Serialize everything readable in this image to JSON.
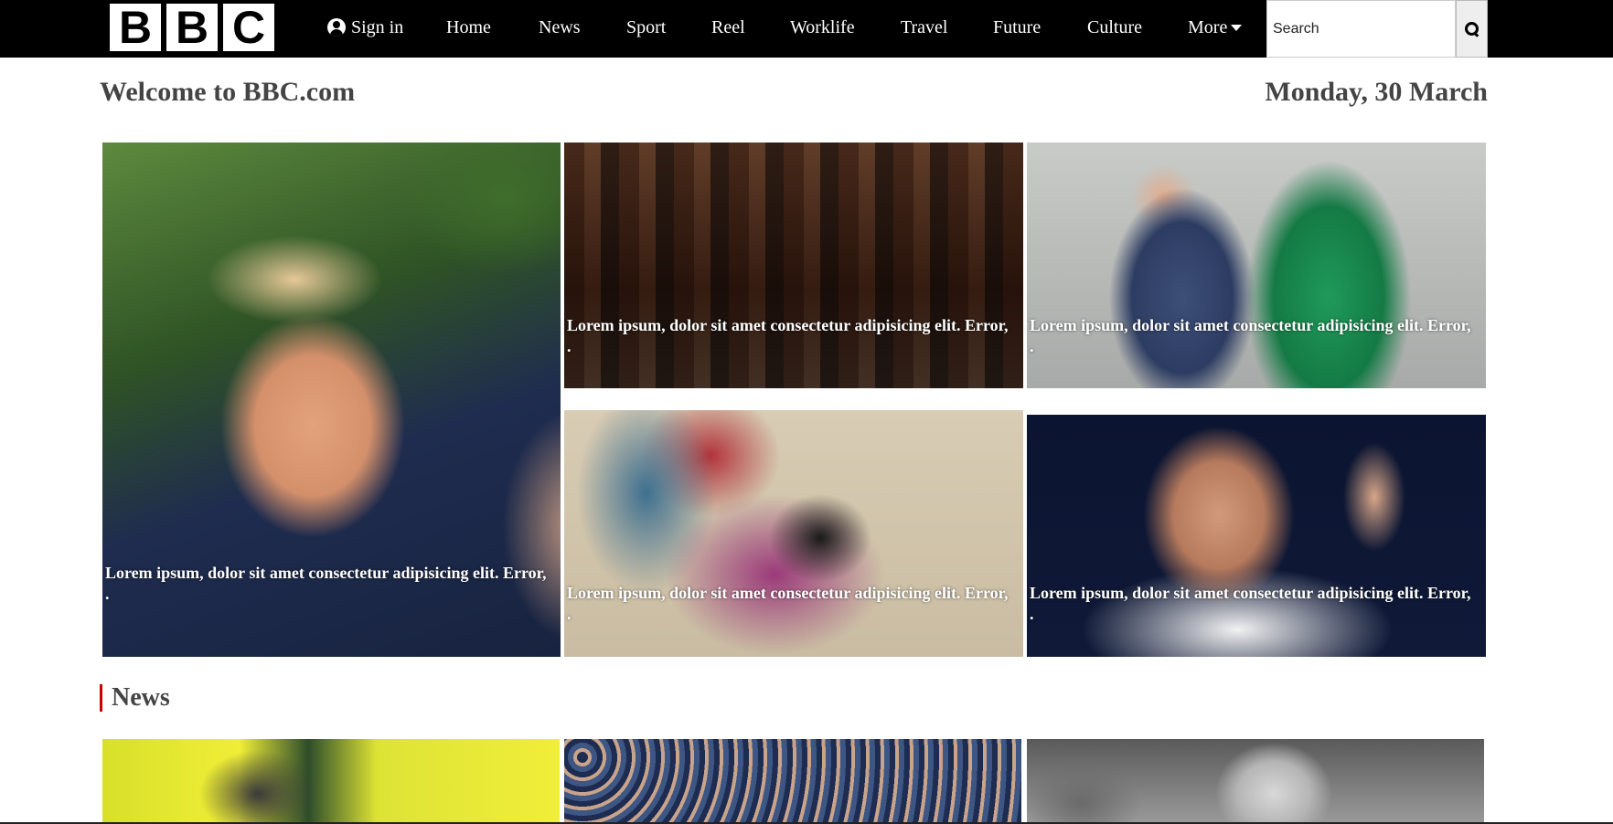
{
  "logo": {
    "letters": [
      "B",
      "B",
      "C"
    ]
  },
  "nav": {
    "sign_in": "Sign in",
    "items": [
      "Home",
      "News",
      "Sport",
      "Reel",
      "Worklife",
      "Travel",
      "Future",
      "Culture"
    ],
    "more": "More",
    "search_placeholder": "Search"
  },
  "page": {
    "welcome": "Welcome to BBC.com",
    "date": "Monday, 30 March"
  },
  "featured": {
    "caption": "Lorem ipsum, dolor sit amet consectetur adipisicing elit. Error, .",
    "cards": [
      {
        "image": "trump-press-photo"
      },
      {
        "image": "city-street-photo"
      },
      {
        "image": "royal-couple-photo"
      },
      {
        "image": "japanese-woodblock-print"
      },
      {
        "image": "footballer-waving-photo"
      }
    ]
  },
  "news": {
    "title": "News",
    "cards": [
      {
        "image": "ambulances-photo"
      },
      {
        "image": "crowd-masks-photo"
      },
      {
        "image": "elderly-man-photo"
      }
    ]
  },
  "colors": {
    "topbar": "#000000",
    "accent": "#cc0000",
    "heading": "#444444"
  }
}
